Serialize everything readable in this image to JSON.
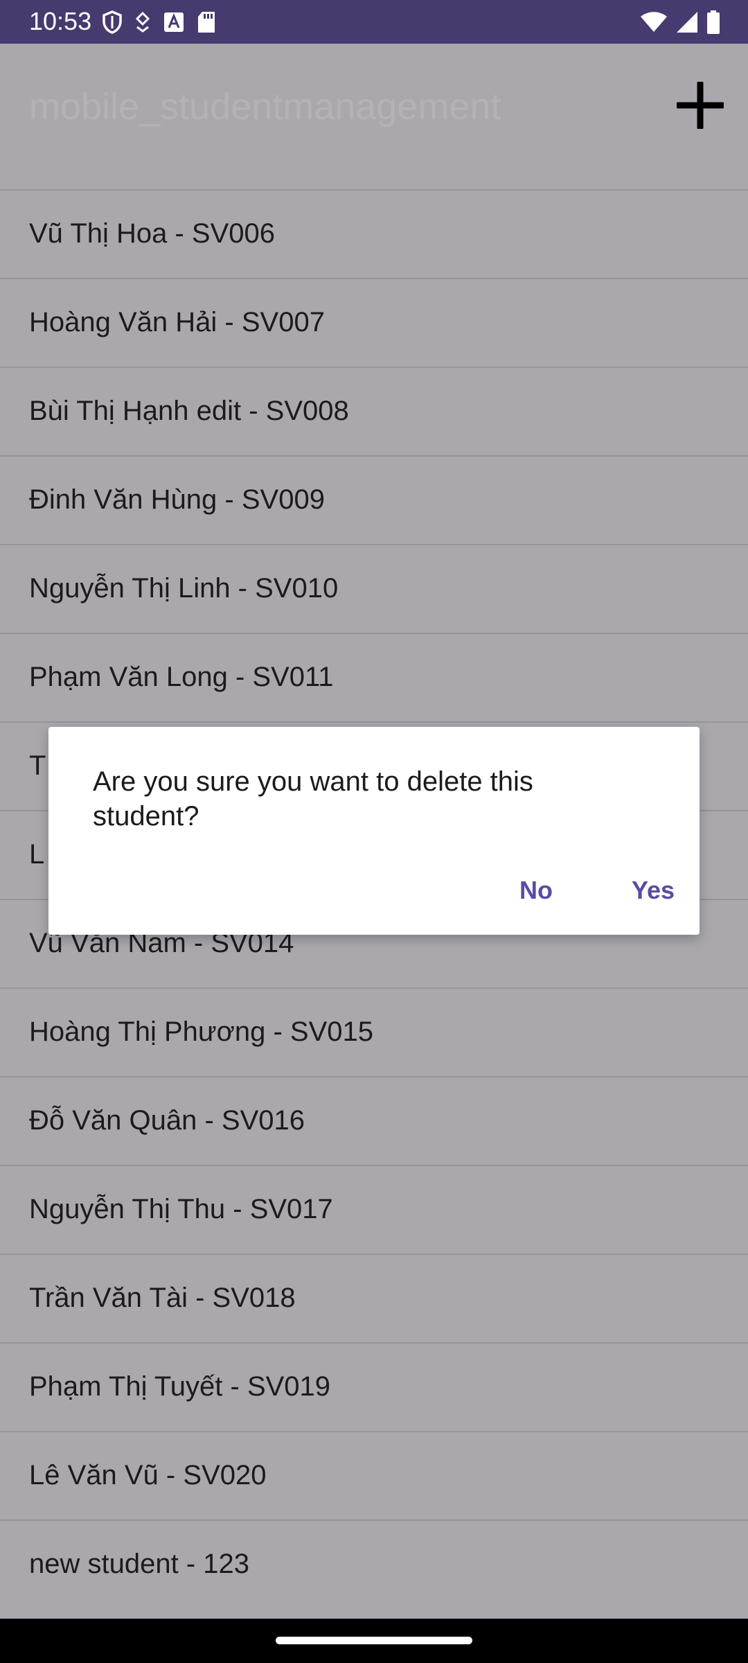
{
  "status_bar": {
    "time": "10:53",
    "left_icons": [
      "shield-icon",
      "data-saver-icon",
      "font-a-icon",
      "sd-card-icon"
    ],
    "right_icons": [
      "wifi-icon",
      "cellular-signal-icon",
      "battery-icon"
    ],
    "background": "#463a6e"
  },
  "app_bar": {
    "title": "mobile_studentmanagement",
    "add_icon": "plus-icon"
  },
  "students": [
    "Vũ Thị Hoa - SV006",
    "Hoàng Văn Hải - SV007",
    "Bùi Thị Hạnh edit - SV008",
    "Đinh Văn Hùng - SV009",
    "Nguyễn Thị Linh - SV010",
    "Phạm Văn Long - SV011",
    "T",
    "L",
    "Vũ Văn Nam - SV014",
    "Hoàng Thị Phương - SV015",
    "Đỗ Văn Quân - SV016",
    "Nguyễn Thị Thu - SV017",
    "Trần Văn Tài - SV018",
    "Phạm Thị Tuyết - SV019",
    "Lê Văn Vũ - SV020",
    "new student - 123"
  ],
  "dialog": {
    "message": "Are you sure you want to delete this student?",
    "no_label": "No",
    "yes_label": "Yes",
    "accent": "#5a4aa5"
  }
}
